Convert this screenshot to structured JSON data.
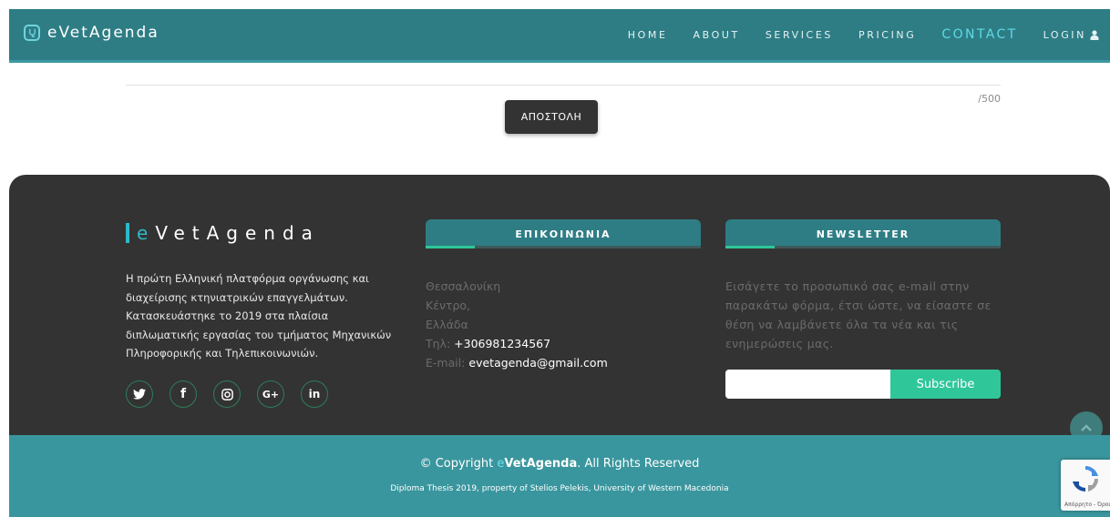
{
  "navbar": {
    "brand": "eVetAgenda",
    "items": [
      {
        "label": "HOME",
        "active": false
      },
      {
        "label": "ABOUT",
        "active": false
      },
      {
        "label": "SERVICES",
        "active": false
      },
      {
        "label": "PRICING",
        "active": false
      },
      {
        "label": "CONTACT",
        "active": true
      }
    ],
    "login_label": "LOGIN",
    "login_icon": "user-icon"
  },
  "form": {
    "char_count": "/500",
    "submit_label": "ΑΠΟΣΤΟΛΗ"
  },
  "footer": {
    "brand_e": "e",
    "brand_rest": "VetAgenda",
    "description": "Η πρώτη Ελληνική πλατφόρμα οργάνωσης και διαχείρισης κτηνιατρικών επαγγελμάτων. Κατασκευάστηκε το 2019 στα πλαίσια διπλωματικής εργασίας του τμήματος Μηχανικών Πληροφορικής και Τηλεπικοινωνιών.",
    "socials": [
      "twitter-icon",
      "facebook-icon",
      "instagram-icon",
      "google-plus-icon",
      "linkedin-icon"
    ],
    "social_glyphs": [
      "🐦",
      "f",
      "◎",
      "G+",
      "in"
    ],
    "contact": {
      "heading": "ΕΠΙΚΟΙΝΩΝΙΑ",
      "city": "Θεσσαλονίκη",
      "area": "Κέντρο,",
      "country": "Ελλάδα",
      "phone_label": "Τηλ: ",
      "phone": "+306981234567",
      "email_label": "E-mail: ",
      "email": "evetagenda@gmail.com"
    },
    "newsletter": {
      "heading": "NEWSLETTER",
      "description": "Εισάγετε το προσωπικό σας e-mail στην παρακάτω φόρμα, έτσι ώστε, να είσαστε σε θέση να λαμβάνετε όλα τα νέα και τις ενημερώσεις μας.",
      "input_value": "",
      "subscribe_label": "Subscribe"
    }
  },
  "bottom": {
    "copyright_prefix": "© Copyright ",
    "copyright_brand_e": "e",
    "copyright_brand": "VetAgenda",
    "copyright_suffix": ". All Rights Reserved",
    "thesis": "Diploma Thesis 2019, property of Stelios Pelekis, University of Western Macedonia"
  },
  "recaptcha": {
    "text": "Απόρρητο - Όροι"
  },
  "colors": {
    "navbar": "#2e7d85",
    "accent": "#2fb9c6",
    "footer_dark": "#333333",
    "subscribe": "#2fc79a",
    "bottom_bar": "#3a969e"
  }
}
